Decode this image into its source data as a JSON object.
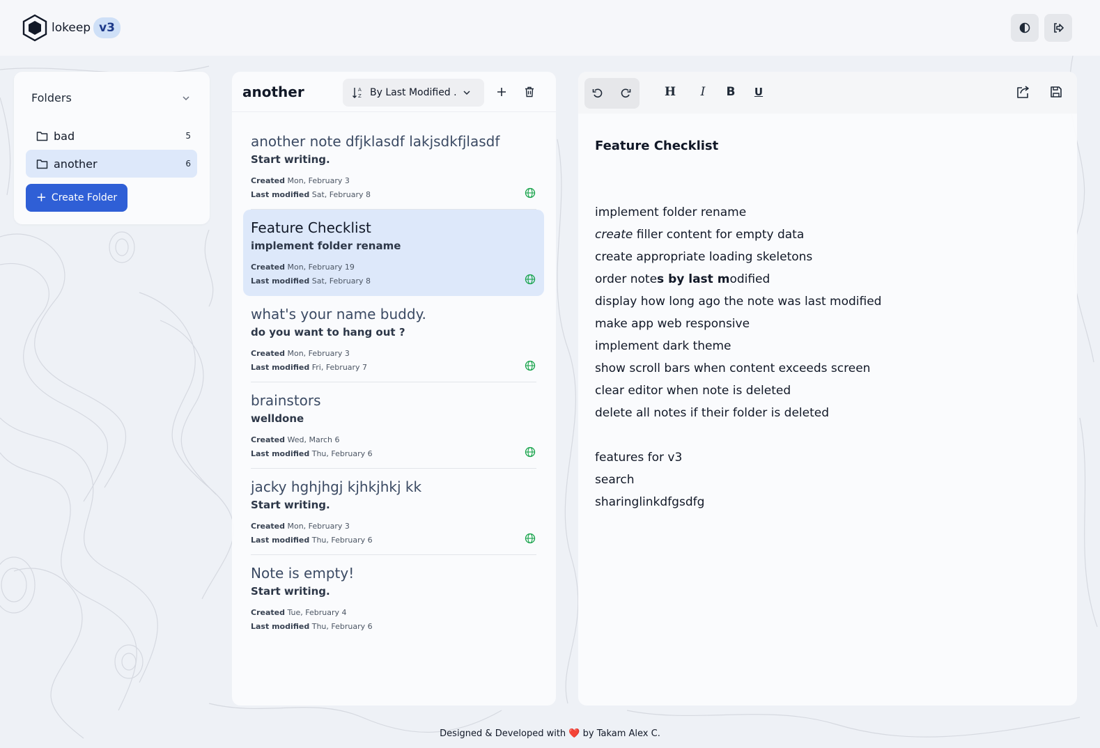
{
  "app": {
    "name": "lokeep",
    "version": "v3"
  },
  "folders": {
    "title": "Folders",
    "items": [
      {
        "name": "bad",
        "count": "5"
      },
      {
        "name": "another",
        "count": "6"
      }
    ],
    "create_label": "Create Folder"
  },
  "notes_panel": {
    "folder_title": "another",
    "sort_label": "By Last Modified ...",
    "created_label": "Created",
    "modified_label": "Last modified",
    "notes": [
      {
        "title": "another note dfjklasdf lakjsdkfjlasdf",
        "preview": "Start writing.",
        "created": "Mon, February 3",
        "modified": "Sat, February 8",
        "shared": true
      },
      {
        "title": "Feature Checklist",
        "preview": "implement folder rename",
        "created": "Mon, February 19",
        "modified": "Sat, February 8",
        "shared": true
      },
      {
        "title": "what's your name buddy.",
        "preview": "do you want to hang out ?",
        "created": "Mon, February 3",
        "modified": "Fri, February 7",
        "shared": true
      },
      {
        "title": "brainstors",
        "preview": "welldone",
        "created": "Wed, March 6",
        "modified": "Thu, February 6",
        "shared": true
      },
      {
        "title": "jacky hghjhgj kjhkjhkj kk",
        "preview": "Start writing.",
        "created": "Mon, February 3",
        "modified": "Thu, February 6",
        "shared": true
      },
      {
        "title": "Note is empty!",
        "preview": "Start writing.",
        "created": "Tue, February 4",
        "modified": "Thu, February 6",
        "shared": false
      }
    ]
  },
  "editor": {
    "toolbar": {
      "heading": "H",
      "italic": "I",
      "bold": "B",
      "underline": "U"
    },
    "heading": "Feature Checklist",
    "lines": [
      "implement folder rename",
      "filler content for empty data",
      "create appropriate loading skeletons",
      "order notes by last modified",
      "display how long ago the note was last modified",
      "make app web responsive",
      "implement dark theme",
      "show scroll bars when content exceeds screen",
      "clear editor when note is deleted",
      "delete all notes if their folder is deleted",
      "features for v3",
      "search",
      "sharinglinkdfgsdfg"
    ],
    "line2_italic_part": "create",
    "line2_rest": " filler content for empty data",
    "line4_parts": [
      "order note",
      "s by last m",
      "odified"
    ]
  },
  "footer": {
    "text_before": "Designed & Developed with ",
    "heart": "❤️",
    "text_after": " by Takam Alex C."
  },
  "colors": {
    "accent": "#2f5fd6",
    "active_bg": "#dde8fa",
    "globe": "#16a34a"
  }
}
